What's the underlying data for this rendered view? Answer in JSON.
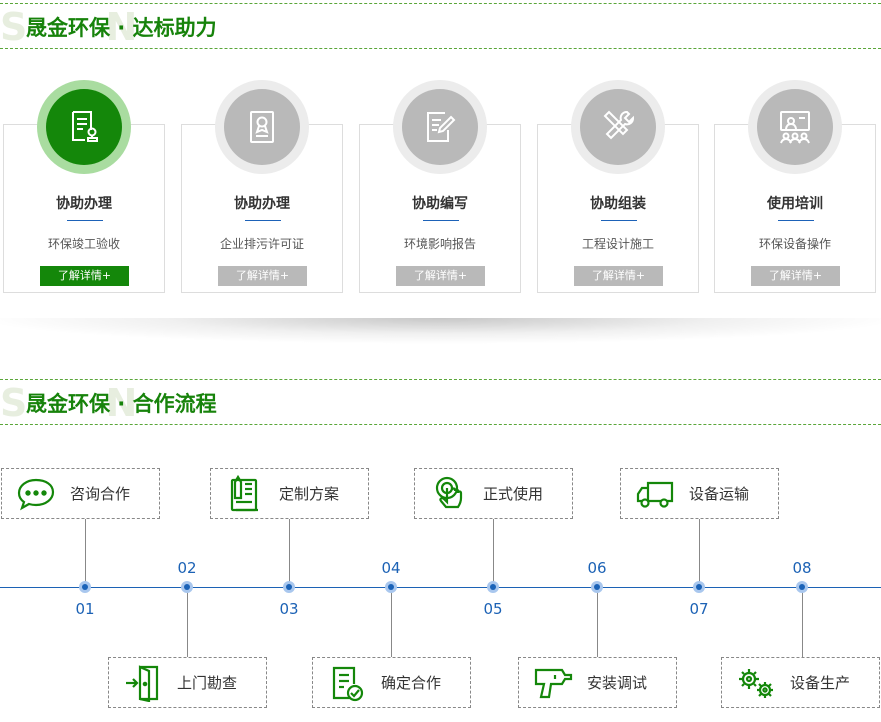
{
  "section1": {
    "title": "晟金环保 · 达标助力"
  },
  "section2": {
    "title": "晟金环保 · 合作流程"
  },
  "services": [
    {
      "title": "协助办理",
      "subtitle": "环保竣工验收",
      "button": "了解详情+",
      "icon": "document-stamp-icon",
      "active": true
    },
    {
      "title": "协助办理",
      "subtitle": "企业排污许可证",
      "button": "了解详情+",
      "icon": "certificate-icon",
      "active": false
    },
    {
      "title": "协助编写",
      "subtitle": "环境影响报告",
      "button": "了解详情+",
      "icon": "document-edit-icon",
      "active": false
    },
    {
      "title": "协助组装",
      "subtitle": "工程设计施工",
      "button": "了解详情+",
      "icon": "tools-icon",
      "active": false
    },
    {
      "title": "使用培训",
      "subtitle": "环保设备操作",
      "button": "了解详情+",
      "icon": "training-icon",
      "active": false
    }
  ],
  "process": [
    {
      "num": "01",
      "label": "咨询合作",
      "icon": "chat-icon"
    },
    {
      "num": "02",
      "label": "上门勘查",
      "icon": "door-enter-icon"
    },
    {
      "num": "03",
      "label": "定制方案",
      "icon": "plan-icon"
    },
    {
      "num": "04",
      "label": "确定合作",
      "icon": "confirm-doc-icon"
    },
    {
      "num": "05",
      "label": "正式使用",
      "icon": "touch-icon"
    },
    {
      "num": "06",
      "label": "安装调试",
      "icon": "drill-icon"
    },
    {
      "num": "07",
      "label": "设备运输",
      "icon": "truck-icon"
    },
    {
      "num": "08",
      "label": "设备生产",
      "icon": "gears-icon"
    }
  ],
  "colors": {
    "brand_green": "#14870a",
    "accent_blue": "#1c62b5",
    "inactive_gray": "#b9b9b9"
  }
}
